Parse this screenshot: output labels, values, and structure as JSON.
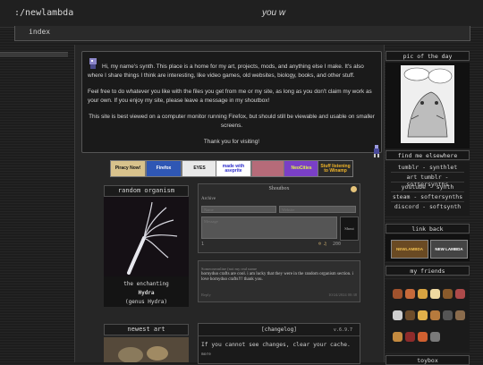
{
  "site": {
    "path": ":/newlambda",
    "tagline": "you w"
  },
  "nav": {
    "index": "index"
  },
  "intro": {
    "p1": "Hi, my name's synth. This place is a home for my art, projects, mods, and anything else I make. It's also where I share things I think are interesting, like video games, old websites, biology, books, and other stuff.",
    "p2": "Feel free to do whatever you like with the files you get from me or my site, as long as you don't claim my work as your own. If you enjoy my site, please leave a message in my shoutbox!",
    "p3": "This site is best viewed on a computer monitor running Firefox, but should still be viewable and usable on smaller screens.",
    "p4": "Thank you for visiting!"
  },
  "badges": [
    {
      "text": "Piracy Now!",
      "bg": "#d8c28c",
      "fg": "#111111"
    },
    {
      "text": "Firefox",
      "bg": "#2f57b4",
      "fg": "#ffffff"
    },
    {
      "text": "EYES",
      "bg": "#e9e9e9",
      "fg": "#111111"
    },
    {
      "text": "made with aseprite",
      "bg": "#ffffff",
      "fg": "#2e2ecc"
    },
    {
      "text": "",
      "bg": "#b66b79",
      "fg": "#ffffff"
    },
    {
      "text": "NeoCities",
      "bg": "#7a3fc6",
      "fg": "#e3f54a"
    },
    {
      "text": "Stuff listening to Winamp",
      "bg": "#2a2a2a",
      "fg": "#f0b429"
    }
  ],
  "organism": {
    "header": "random organism",
    "caption1": "the enchanting",
    "name": "Hydra",
    "genus": "(genus Hydra)"
  },
  "newest_art": {
    "header": "newest art"
  },
  "shoutbox": {
    "title": "Shoutbox",
    "archive": "Archive",
    "name_placeholder": "Name",
    "website_placeholder": "Website",
    "message_placeholder": "Message",
    "send": "Shout",
    "counter": "200",
    "page_left": "1",
    "msg_name": "Someoneonline (not my real name",
    "msg_text": "hornyduo crafts are cool. i am lucky that they were in the random organism section. i love hornyduo crafts!!! thank you.",
    "msg_meta": "Reply",
    "msg_date": "10/24/2024 00:38"
  },
  "changelog": {
    "title": "[changelog]",
    "version": "v.6.9.7",
    "text": "If you cannot see changes, clear your cache.",
    "more": "more"
  },
  "sidebar": {
    "potd": "pic of the day",
    "elsewhere": "find me elsewhere",
    "links": [
      "tumblr - synthlet",
      "art tumblr - softersynths",
      "youtube - synth",
      "steam - softersynths",
      "discord - softsynth"
    ],
    "linkback": "link back",
    "linkback_badges": [
      {
        "text": "NEWLAMBDA",
        "bg": "#6a4a23",
        "fg": "#f0c050"
      },
      {
        "text": "NEW LAMBDA",
        "bg": "#444444",
        "fg": "#ffffff"
      }
    ],
    "friends": "my friends",
    "friend_colors": [
      "#a0522d",
      "#c76a3a",
      "#d9a441",
      "#efd9a0",
      "#8a5a2b",
      "#ad4a4a",
      "#cfcfcf",
      "#6d4c2a",
      "#e0b04a",
      "#b77a3d",
      "#555555",
      "#8a6b4c",
      "#c48a3f",
      "#8e2b2b",
      "#d06030",
      "#7a7a7a"
    ],
    "toybox": "toybox"
  },
  "colors": {
    "accent": "#d6d6d6",
    "panel": "#1b1b1b"
  }
}
